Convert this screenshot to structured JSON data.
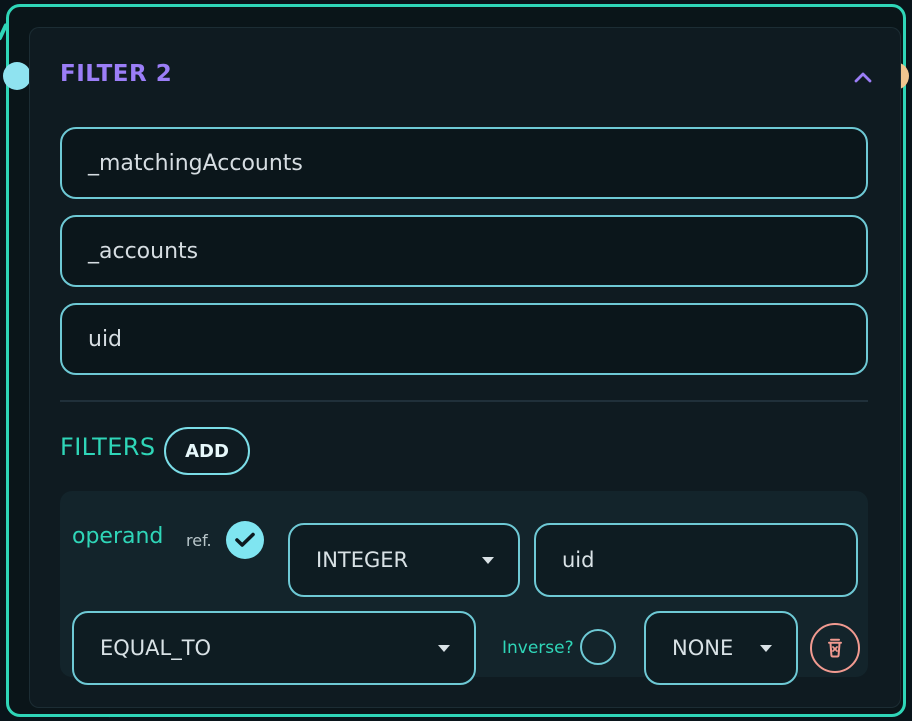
{
  "header": {
    "title": "FILTER 2"
  },
  "fields": {
    "field_1": "_matchingAccounts",
    "field_2": "_accounts",
    "field_3": "uid"
  },
  "filters": {
    "label": "FILTERS",
    "add_label": "ADD",
    "items": [
      {
        "operand_label": "operand",
        "ref_label": "ref.",
        "ref_checked": true,
        "type": "INTEGER",
        "value": "uid",
        "operator": "EQUAL_TO",
        "inverse_label": "Inverse?",
        "inverse_checked": false,
        "combine": "NONE"
      }
    ]
  },
  "icons": {
    "collapse": "chevron-up-icon",
    "checkbox": "check-icon",
    "dropdown": "chevron-down-icon",
    "delete": "trash-icon"
  },
  "colors": {
    "accent_teal": "#2fd6b8",
    "accent_purple": "#9b7ef7",
    "accent_cyan": "#7fe5f1",
    "accent_peach": "#f0c58f",
    "danger": "#f19a90"
  }
}
